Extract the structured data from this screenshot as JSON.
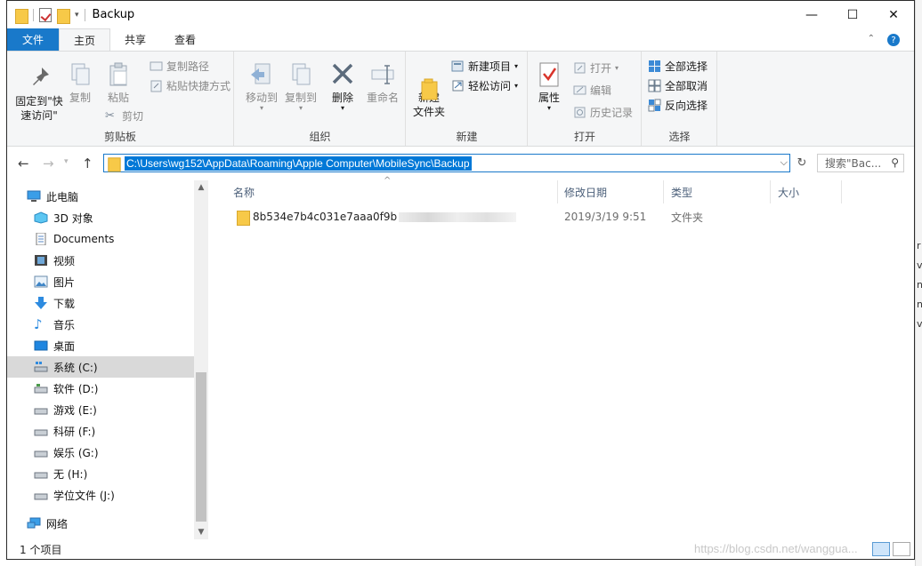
{
  "window": {
    "title": "Backup",
    "minimize": "—",
    "maximize": "☐",
    "close": "✕"
  },
  "ribbon_tabs": [
    {
      "label": "文件"
    },
    {
      "label": "主页"
    },
    {
      "label": "共享"
    },
    {
      "label": "查看"
    }
  ],
  "ribbon": {
    "clipboard": {
      "pin": "固定到\"快速访问\"",
      "copy": "复制",
      "paste": "粘贴",
      "copy_path": "复制路径",
      "paste_shortcut": "粘贴快捷方式",
      "cut": "剪切",
      "label": "剪贴板"
    },
    "organize": {
      "move_to": "移动到",
      "copy_to": "复制到",
      "delete": "删除",
      "rename": "重命名",
      "label": "组织"
    },
    "new": {
      "new_folder": "新建\n文件夹",
      "new_item": "新建项目",
      "easy_access": "轻松访问",
      "label": "新建"
    },
    "open": {
      "properties": "属性",
      "open": "打开",
      "edit": "编辑",
      "history": "历史记录",
      "label": "打开"
    },
    "select": {
      "select_all": "全部选择",
      "select_none": "全部取消",
      "invert": "反向选择",
      "label": "选择"
    }
  },
  "address": {
    "path": "C:\\Users\\wg152\\AppData\\Roaming\\Apple Computer\\MobileSync\\Backup",
    "search_placeholder": "搜索\"Bac..."
  },
  "nav_pane": [
    {
      "label": "此电脑",
      "icon": "pc-icon"
    },
    {
      "label": "3D 对象",
      "icon": "3d-objects-icon"
    },
    {
      "label": "Documents",
      "icon": "documents-icon"
    },
    {
      "label": "视频",
      "icon": "video-icon"
    },
    {
      "label": "图片",
      "icon": "pictures-icon"
    },
    {
      "label": "下载",
      "icon": "download-icon"
    },
    {
      "label": "音乐",
      "icon": "music-icon"
    },
    {
      "label": "桌面",
      "icon": "desktop-icon"
    },
    {
      "label": "系统 (C:)",
      "icon": "system-drive-icon",
      "selected": true
    },
    {
      "label": "软件 (D:)",
      "icon": "drive-icon"
    },
    {
      "label": "游戏 (E:)",
      "icon": "drive-icon"
    },
    {
      "label": "科研 (F:)",
      "icon": "drive-icon"
    },
    {
      "label": "娱乐 (G:)",
      "icon": "drive-icon"
    },
    {
      "label": "无 (H:)",
      "icon": "drive-icon"
    },
    {
      "label": "学位文件 (J:)",
      "icon": "drive-icon"
    },
    {
      "label": "网络",
      "icon": "network-icon"
    }
  ],
  "columns": {
    "name": "名称",
    "modified": "修改日期",
    "type": "类型",
    "size": "大小"
  },
  "files": [
    {
      "name": "8b534e7b4c031e7aaa0f9b",
      "modified": "2019/3/19 9:51",
      "type": "文件夹",
      "size": ""
    }
  ],
  "status": {
    "count": "1 个项目",
    "watermark": "https://blog.csdn.net/wanggua..."
  },
  "colors": {
    "accent": "#1979ca",
    "selection": "#0078d7",
    "folder": "#f7c948"
  }
}
